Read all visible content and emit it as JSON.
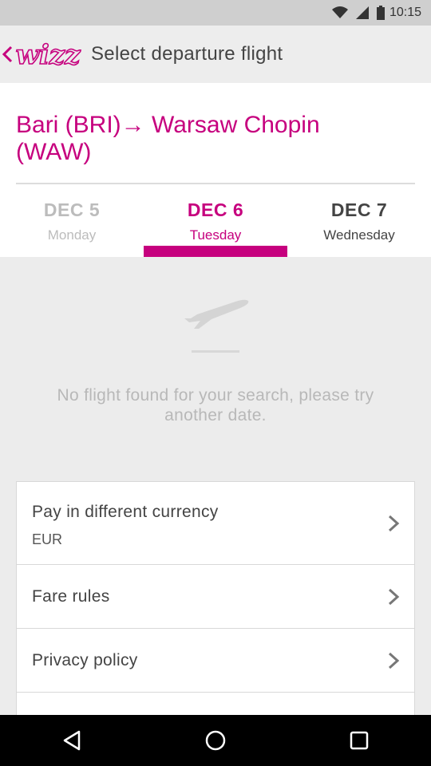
{
  "status_bar": {
    "time": "10:15"
  },
  "toolbar": {
    "title": "Select departure flight",
    "logo_text": "wizz"
  },
  "route": {
    "text": "Bari (BRI)→ Warsaw Chopin (WAW)"
  },
  "date_tabs": [
    {
      "date": "DEC 5",
      "day": "Monday",
      "state": "disabled"
    },
    {
      "date": "DEC 6",
      "day": "Tuesday",
      "state": "active"
    },
    {
      "date": "DEC 7",
      "day": "Wednesday",
      "state": "normal"
    }
  ],
  "empty_state": {
    "message": "No flight found for your search, please try another date."
  },
  "options": {
    "currency": {
      "title": "Pay in different currency",
      "value": "EUR"
    },
    "fare_rules": {
      "title": "Fare rules"
    },
    "privacy": {
      "title": "Privacy policy"
    }
  },
  "colors": {
    "brand": "#c6007e",
    "muted": "#bcbcbc",
    "background": "#ececec"
  },
  "icons": [
    "wifi-icon",
    "signal-icon",
    "battery-icon",
    "back-arrow-icon",
    "wizz-logo",
    "airplane-icon",
    "chevron-right-icon",
    "nav-back-icon",
    "nav-home-icon",
    "nav-recents-icon"
  ]
}
